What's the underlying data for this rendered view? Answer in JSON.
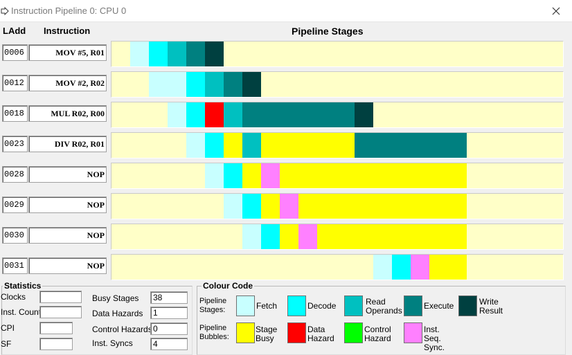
{
  "window": {
    "title": "Instruction Pipeline 0: CPU 0"
  },
  "headers": {
    "ladd": "LAdd",
    "instruction": "Instruction",
    "pipeline": "Pipeline Stages"
  },
  "colors": {
    "empty": "#ffffc8",
    "fetch": "#c8ffff",
    "decode": "#00ffff",
    "read": "#00c0c0",
    "execute": "#008080",
    "write": "#004040",
    "busy": "#ffff00",
    "data_hazard": "#ff0000",
    "control_hazard": "#00ff00",
    "inst_sync": "#ff80ff"
  },
  "rows": [
    {
      "addr": "0006",
      "instr": "MOV #5, R01",
      "segments": [
        [
          "fetch",
          1
        ],
        [
          "decode",
          1
        ],
        [
          "read",
          1
        ],
        [
          "execute",
          1
        ],
        [
          "write",
          1
        ]
      ],
      "start": 1
    },
    {
      "addr": "0012",
      "instr": "MOV #2, R02",
      "segments": [
        [
          "fetch",
          2
        ],
        [
          "decode",
          1
        ],
        [
          "read",
          1
        ],
        [
          "execute",
          1
        ],
        [
          "write",
          1
        ]
      ],
      "start": 2
    },
    {
      "addr": "0018",
      "instr": "MUL R02, R00",
      "segments": [
        [
          "fetch",
          1
        ],
        [
          "decode",
          1
        ],
        [
          "data_hazard",
          1
        ],
        [
          "read",
          1
        ],
        [
          "execute",
          6
        ],
        [
          "write",
          1
        ]
      ],
      "start": 3
    },
    {
      "addr": "0023",
      "instr": "DIV R02, R01",
      "segments": [
        [
          "fetch",
          1
        ],
        [
          "decode",
          1
        ],
        [
          "busy",
          1
        ],
        [
          "read",
          1
        ],
        [
          "busy",
          5
        ],
        [
          "execute",
          6
        ]
      ],
      "start": 4
    },
    {
      "addr": "0028",
      "instr": "NOP",
      "segments": [
        [
          "fetch",
          1
        ],
        [
          "decode",
          1
        ],
        [
          "busy",
          1
        ],
        [
          "inst_sync",
          1
        ],
        [
          "busy",
          10
        ]
      ],
      "start": 5
    },
    {
      "addr": "0029",
      "instr": "NOP",
      "segments": [
        [
          "fetch",
          1
        ],
        [
          "decode",
          1
        ],
        [
          "busy",
          1
        ],
        [
          "inst_sync",
          1
        ],
        [
          "busy",
          9
        ]
      ],
      "start": 6
    },
    {
      "addr": "0030",
      "instr": "NOP",
      "segments": [
        [
          "fetch",
          1
        ],
        [
          "decode",
          1
        ],
        [
          "busy",
          1
        ],
        [
          "inst_sync",
          1
        ],
        [
          "busy",
          8
        ]
      ],
      "start": 7
    },
    {
      "addr": "0031",
      "instr": "NOP",
      "segments": [
        [
          "fetch",
          1
        ],
        [
          "decode",
          1
        ],
        [
          "inst_sync",
          1
        ],
        [
          "busy",
          2
        ]
      ],
      "start": 14
    }
  ],
  "statistics": {
    "title": "Statistics",
    "clocks_label": "Clocks",
    "clocks_value": "",
    "inst_count_label": "Inst. Count",
    "inst_count_value": "",
    "cpi_label": "CPI",
    "cpi_value": "",
    "sf_label": "SF",
    "sf_value": "",
    "busy_stages_label": "Busy Stages",
    "busy_stages_value": "38",
    "data_hazards_label": "Data Hazards",
    "data_hazards_value": "1",
    "control_hazards_label": "Control Hazards",
    "control_hazards_value": "0",
    "inst_syncs_label": "Inst. Syncs",
    "inst_syncs_value": "4"
  },
  "colour_code": {
    "title": "Colour Code",
    "stages_label": "Pipeline Stages:",
    "bubbles_label": "Pipeline Bubbles:",
    "fetch": "Fetch",
    "decode": "Decode",
    "read": "Read Operands",
    "execute": "Execute",
    "write": "Write Result",
    "busy": "Stage Busy",
    "data_hazard": "Data Hazard",
    "control_hazard": "Control Hazard",
    "inst_sync": "Inst. Seq. Sync."
  }
}
